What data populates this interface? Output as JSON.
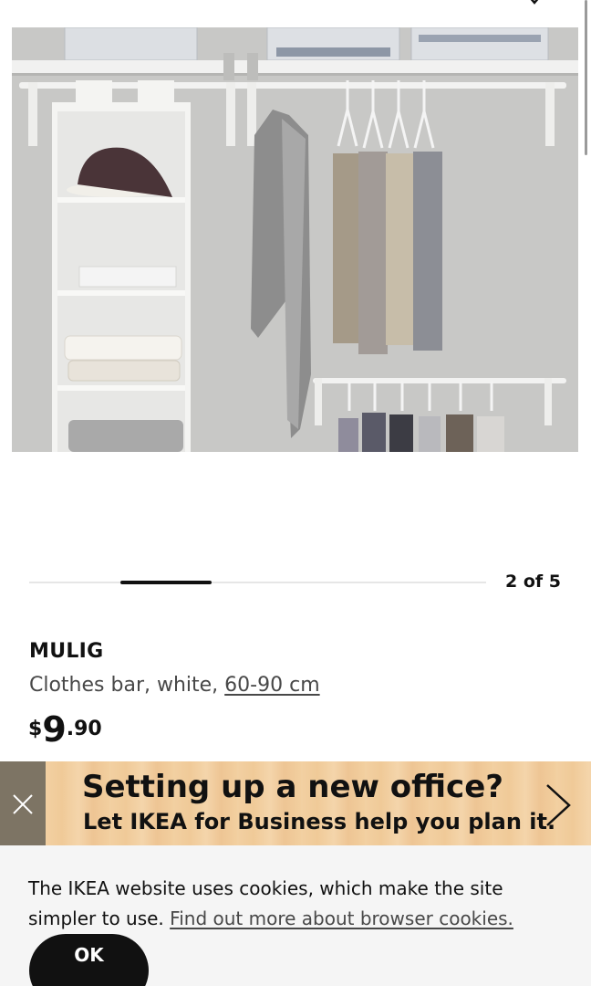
{
  "carousel": {
    "counter": "2 of 5",
    "current": 2,
    "total": 5
  },
  "product": {
    "name": "MULIG",
    "description": "Clothes bar, white, ",
    "size_link": "60-90 cm",
    "price": {
      "currency": "$",
      "integer": "9",
      "decimal": ".90"
    }
  },
  "banner": {
    "title": "Setting up a new office?",
    "subtitle": "Let IKEA for Business help you plan it."
  },
  "cookie": {
    "text": "The IKEA website uses cookies, which make the site simpler to use. ",
    "link": "Find out more about browser cookies.",
    "ok_label": "OK"
  },
  "icons": {
    "top": "chevron-down-icon",
    "banner_close": "close-icon",
    "banner_next": "chevron-right-icon"
  },
  "colors": {
    "text": "#111111",
    "muted_text": "#484848",
    "banner_close_bg": "#7d7464",
    "banner_bg": "#f2d0a2",
    "cookie_bg": "#f5f5f5",
    "button_bg": "#111111"
  }
}
